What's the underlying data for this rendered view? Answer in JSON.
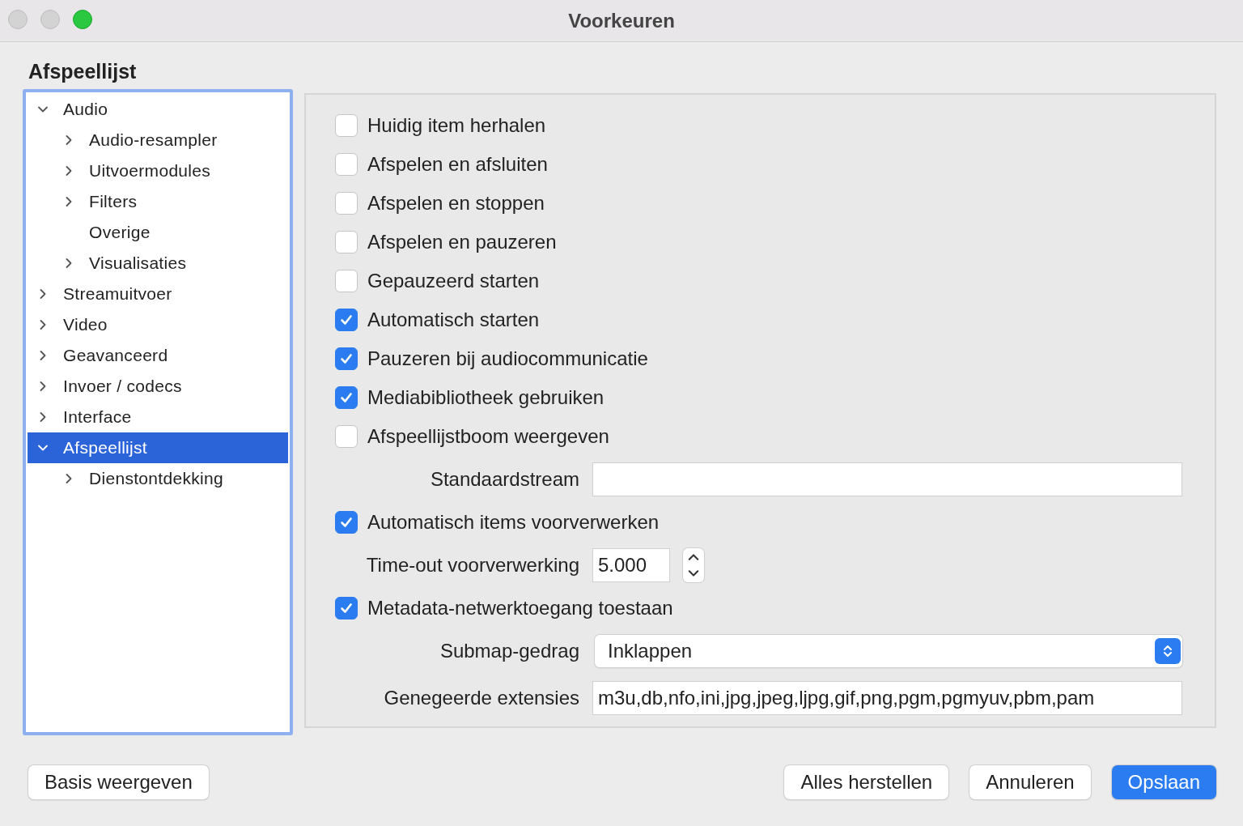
{
  "window": {
    "title": "Voorkeuren"
  },
  "section_title": "Afspeellijst",
  "sidebar": {
    "items": [
      {
        "label": "Audio",
        "expanded": true,
        "selected": false,
        "children": [
          {
            "label": "Audio-resampler",
            "expanded": false,
            "selected": false
          },
          {
            "label": "Uitvoermodules",
            "expanded": false,
            "selected": false
          },
          {
            "label": "Filters",
            "expanded": false,
            "selected": false
          },
          {
            "label": "Overige",
            "selected": false
          },
          {
            "label": "Visualisaties",
            "expanded": false,
            "selected": false
          }
        ]
      },
      {
        "label": "Streamuitvoer",
        "expanded": false,
        "selected": false
      },
      {
        "label": "Video",
        "expanded": false,
        "selected": false
      },
      {
        "label": "Geavanceerd",
        "expanded": false,
        "selected": false
      },
      {
        "label": "Invoer / codecs",
        "expanded": false,
        "selected": false
      },
      {
        "label": "Interface",
        "expanded": false,
        "selected": false
      },
      {
        "label": "Afspeellijst",
        "expanded": true,
        "selected": true,
        "children": [
          {
            "label": "Dienstontdekking",
            "expanded": false,
            "selected": false
          }
        ]
      }
    ]
  },
  "settings": [
    {
      "kind": "checkbox",
      "label": "Huidig item herhalen",
      "checked": false
    },
    {
      "kind": "checkbox",
      "label": "Afspelen en afsluiten",
      "checked": false
    },
    {
      "kind": "checkbox",
      "label": "Afspelen en stoppen",
      "checked": false
    },
    {
      "kind": "checkbox",
      "label": "Afspelen en pauzeren",
      "checked": false
    },
    {
      "kind": "checkbox",
      "label": "Gepauzeerd starten",
      "checked": false
    },
    {
      "kind": "checkbox",
      "label": "Automatisch starten",
      "checked": true
    },
    {
      "kind": "checkbox",
      "label": "Pauzeren bij audiocommunicatie",
      "checked": true
    },
    {
      "kind": "checkbox",
      "label": "Mediabibliotheek gebruiken",
      "checked": true
    },
    {
      "kind": "checkbox",
      "label": "Afspeellijstboom weergeven",
      "checked": false
    },
    {
      "kind": "text",
      "label": "Standaardstream"
    },
    {
      "kind": "checkbox",
      "label": "Automatisch items voorverwerken",
      "checked": true
    },
    {
      "kind": "number",
      "label": "Time-out voorverwerking",
      "value": "5.000"
    },
    {
      "kind": "checkbox",
      "label": "Metadata-netwerktoegang toestaan",
      "checked": true
    },
    {
      "kind": "dropdown",
      "label": "Submap-gedrag",
      "value": "Inklappen"
    },
    {
      "kind": "text",
      "label": "Genegeerde extensies",
      "value": "m3u,db,nfo,ini,jpg,jpeg,ljpg,gif,png,pgm,pgmyuv,pbm,pam"
    }
  ],
  "buttons_left": [
    {
      "label": "Basis weergeven",
      "default": false
    }
  ],
  "buttons_right": [
    {
      "label": "Alles herstellen",
      "default": false
    },
    {
      "label": "Annuleren",
      "default": false
    },
    {
      "label": "Opslaan",
      "default": true
    }
  ]
}
